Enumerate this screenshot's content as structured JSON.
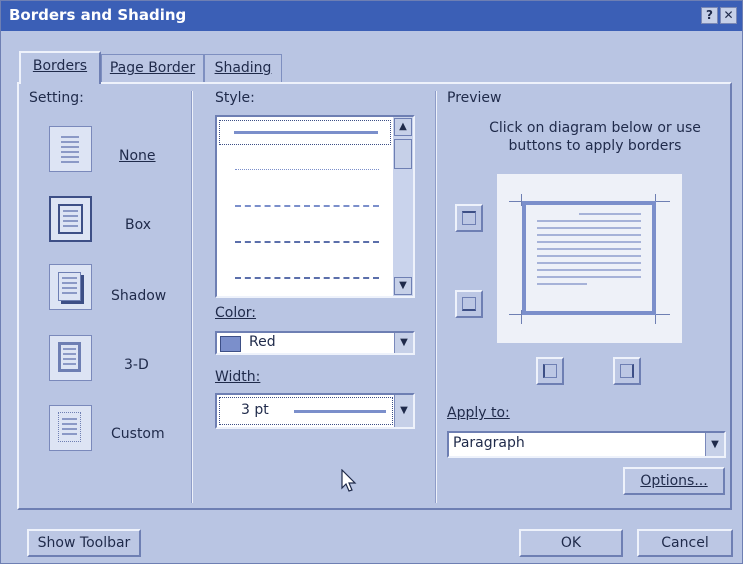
{
  "dialog": {
    "title": "Borders and Shading",
    "help_label": "?",
    "close_label": "✕"
  },
  "tabs": [
    {
      "label": "Borders",
      "active": true
    },
    {
      "label": "Page Border",
      "active": false
    },
    {
      "label": "Shading",
      "active": false
    }
  ],
  "setting": {
    "header": "Setting:",
    "items": [
      {
        "label": "None",
        "icon": "setting-none-icon",
        "selected": false
      },
      {
        "label": "Box",
        "icon": "setting-box-icon",
        "selected": true
      },
      {
        "label": "Shadow",
        "icon": "setting-shadow-icon",
        "selected": false
      },
      {
        "label": "3-D",
        "icon": "setting-3d-icon",
        "selected": false
      },
      {
        "label": "Custom",
        "icon": "setting-custom-icon",
        "selected": false
      }
    ]
  },
  "style": {
    "header": "Style:",
    "options": [
      "solid",
      "dotted",
      "dashed-small",
      "dashed",
      "dash-dot"
    ],
    "selected_index": 0
  },
  "color": {
    "header": "Color:",
    "value": "Red",
    "swatch": "#7b8fcb"
  },
  "width": {
    "header": "Width:",
    "value": "3 pt"
  },
  "preview": {
    "header": "Preview",
    "instructions": "Click on diagram below or use buttons to apply borders",
    "buttons": [
      "top-border-icon",
      "bottom-border-icon",
      "left-border-icon",
      "right-border-icon"
    ]
  },
  "apply_to": {
    "header": "Apply to:",
    "value": "Paragraph"
  },
  "buttons": {
    "options": "Options...",
    "show_toolbar": "Show Toolbar",
    "ok": "OK",
    "cancel": "Cancel"
  },
  "colors": {
    "title_bar": "#3b5fb6",
    "dialog_bg": "#b9c5e3",
    "accent": "#7b8fcb"
  }
}
